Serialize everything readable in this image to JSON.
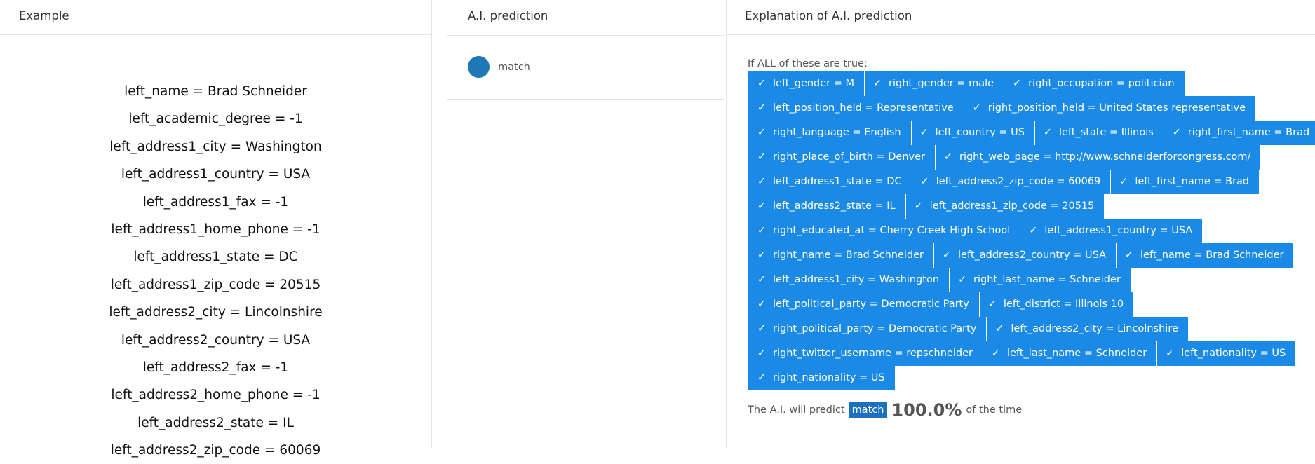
{
  "example": {
    "title": "Example",
    "items": [
      "left_name = Brad Schneider",
      "left_academic_degree = -1",
      "left_address1_city = Washington",
      "left_address1_country = USA",
      "left_address1_fax = -1",
      "left_address1_home_phone = -1",
      "left_address1_state = DC",
      "left_address1_zip_code = 20515",
      "left_address2_city = Lincolnshire",
      "left_address2_country = USA",
      "left_address2_fax = -1",
      "left_address2_home_phone = -1",
      "left_address2_state = IL",
      "left_address2_zip_code = 60069"
    ]
  },
  "prediction": {
    "title": "A.I. prediction",
    "label": "match",
    "color": "#1f77b4"
  },
  "explanation": {
    "title": "Explanation of A.I. prediction",
    "intro": "If ALL of these are true:",
    "check_icon": "check-icon",
    "chip_color": "#1a8ae6",
    "rows": [
      [
        "left_gender = M",
        "right_gender = male",
        "right_occupation = politician"
      ],
      [
        "left_position_held = Representative",
        "right_position_held = United States representative"
      ],
      [
        "right_language = English",
        "left_country = US",
        "left_state = Illinois",
        "right_first_name = Brad"
      ],
      [
        "right_place_of_birth = Denver",
        "right_web_page = http://www.schneiderforcongress.com/"
      ],
      [
        "left_address1_state = DC",
        "left_address2_zip_code = 60069",
        "left_first_name = Brad"
      ],
      [
        "left_address2_state = IL",
        "left_address1_zip_code = 20515"
      ],
      [
        "right_educated_at = Cherry Creek High School",
        "left_address1_country = USA"
      ],
      [
        "right_name = Brad Schneider",
        "left_address2_country = USA",
        "left_name = Brad Schneider"
      ],
      [
        "left_address1_city = Washington",
        "right_last_name = Schneider"
      ],
      [
        "left_political_party = Democratic Party",
        "left_district = Illinois 10"
      ],
      [
        "right_political_party = Democratic Party",
        "left_address2_city = Lincolnshire"
      ],
      [
        "right_twitter_username = repschneider",
        "left_last_name = Schneider",
        "left_nationality = US"
      ],
      [
        "right_nationality = US"
      ]
    ],
    "summary": {
      "prefix": "The A.I. will predict",
      "label": "match",
      "percent": "100.0%",
      "suffix": "of the time"
    }
  }
}
